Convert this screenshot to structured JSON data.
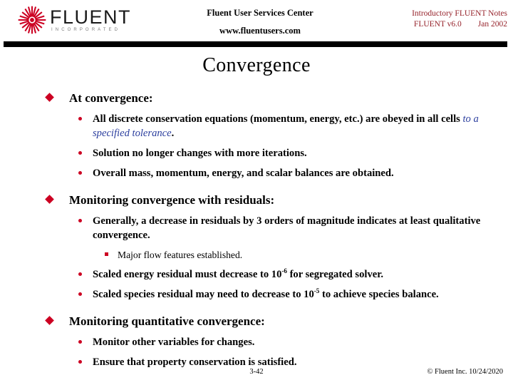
{
  "header": {
    "logo_word": "FLUENT",
    "logo_sub": "INCORPORATED",
    "logo_icon": "fluent-starburst-icon",
    "center_line1": "Fluent User Services Center",
    "center_line2": "www.fluentusers.com",
    "right_line1": "Introductory FLUENT Notes",
    "right_line2": "FLUENT v6.0        Jan 2002",
    "accent_color": "#96232b",
    "rule_color": "#000000"
  },
  "slide": {
    "title": "Convergence",
    "bullet_color": "#cc0022",
    "emphasis_color": "#2b3e9e"
  },
  "content": {
    "b1": "At convergence:",
    "b1_1_a": "All discrete conservation equations (momentum, energy, etc.) are obeyed in all cells ",
    "b1_1_em": "to a specified tolerance",
    "b1_1_b": ".",
    "b1_2": "Solution no longer changes with more iterations.",
    "b1_3": "Overall mass, momentum, energy, and scalar balances are obtained.",
    "b2": "Monitoring convergence with residuals:",
    "b2_1": "Generally, a decrease in residuals by 3 orders of magnitude indicates at least qualitative convergence.",
    "b2_1_1": "Major flow features established.",
    "b2_2_a": "Scaled energy residual must decrease to 10",
    "b2_2_sup": "-6",
    "b2_2_b": " for segregated solver.",
    "b2_3_a": "Scaled species residual may need to decrease to 10",
    "b2_3_sup": "-5",
    "b2_3_b": " to achieve species balance.",
    "b3": "Monitoring quantitative convergence:",
    "b3_1": "Monitor other variables for changes.",
    "b3_2": "Ensure that property conservation is satisfied."
  },
  "footer": {
    "page_number": "3-42",
    "copyright": "© Fluent Inc. 10/24/2020"
  }
}
